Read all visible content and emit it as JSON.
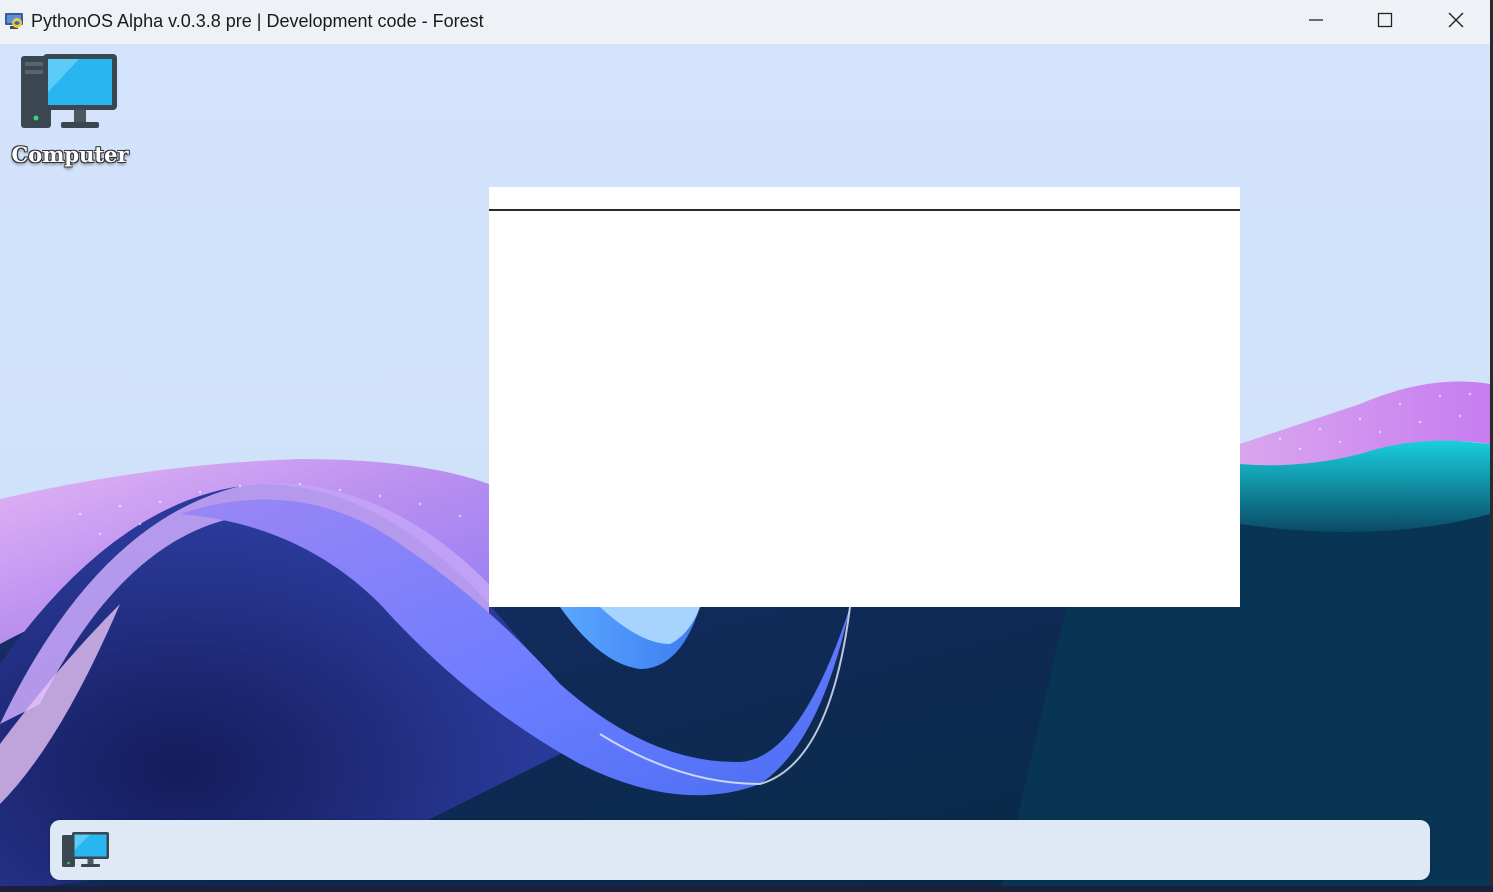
{
  "window": {
    "title": "PythonOS Alpha v.0.3.8 pre | Development code - Forest",
    "controls": {
      "minimize_icon": "minimize-icon",
      "maximize_icon": "maximize-icon",
      "close_icon": "close-icon"
    }
  },
  "desktop": {
    "icons": [
      {
        "label": "Computer",
        "icon": "computer-icon"
      }
    ]
  },
  "taskbar": {
    "items": [
      {
        "icon": "computer-icon"
      }
    ]
  },
  "colors": {
    "titlebar": "#eef2f7",
    "sky": "#d1e2fb",
    "taskbar": "#dfe9f5",
    "monitor_screen": "#29b6f0",
    "monitor_frame": "#3a4750"
  }
}
